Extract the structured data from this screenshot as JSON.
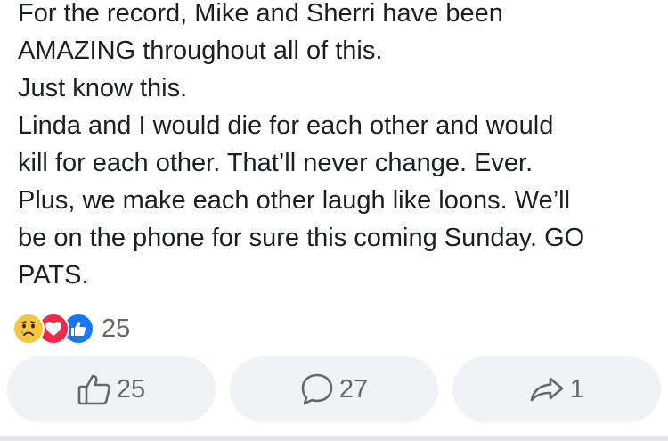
{
  "post": {
    "lines": [
      "For the record, Mike and Sherri have been",
      "AMAZING throughout all of this.",
      "Just know this.",
      "Linda and I would die for each other and would",
      "kill for each other. That’ll never change. Ever.",
      "Plus, we make each other laugh like loons. We’ll",
      "be on the phone for sure this coming Sunday. GO",
      "PATS."
    ]
  },
  "reactions": {
    "icons": [
      "sad-reaction-icon",
      "love-reaction-icon",
      "like-reaction-icon"
    ],
    "count": "25"
  },
  "actions": {
    "like": {
      "icon": "thumbs-up-icon",
      "count": "25"
    },
    "comment": {
      "icon": "comment-bubble-icon",
      "count": "27"
    },
    "share": {
      "icon": "share-arrow-icon",
      "count": "1"
    }
  },
  "colors": {
    "text": "#1c1e21",
    "muted": "#65676b",
    "pill_bg": "#f0f2f5",
    "like_blue": "#1877f2",
    "love_red": "#f0284a",
    "sad_yellow": "#f7c63f"
  }
}
